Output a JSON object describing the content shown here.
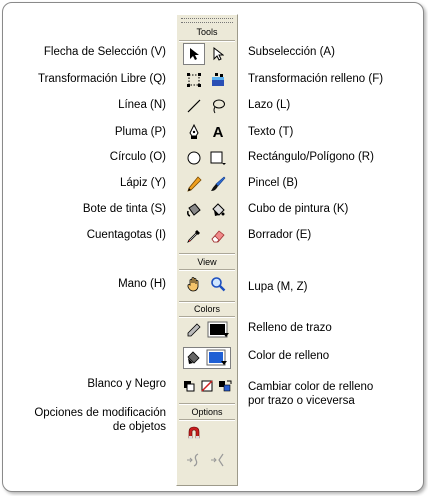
{
  "panel": {
    "tools_title": "Tools",
    "view_title": "View",
    "colors_title": "Colors",
    "options_title": "Options"
  },
  "labels_left": {
    "seleccion": "Flecha de Selección (V)",
    "transformacion_libre": "Transformación Libre (Q)",
    "linea": "Línea (N)",
    "pluma": "Pluma (P)",
    "circulo": "Círculo (O)",
    "lapiz": "Lápiz (Y)",
    "bote": "Bote de tinta (S)",
    "cuentagotas": "Cuentagotas (I)",
    "mano": "Mano (H)",
    "blanco_negro": "Blanco y Negro",
    "opciones_1": "Opciones de modificación",
    "opciones_2": "de objetos"
  },
  "labels_right": {
    "subseleccion": "Subselección (A)",
    "transformacion_relleno": "Transformación relleno (F)",
    "lazo": "Lazo (L)",
    "texto": "Texto (T)",
    "rectangulo": "Rectángulo/Polígono (R)",
    "pincel": "Pincel (B)",
    "cubo": "Cubo de pintura (K)",
    "borrador": "Borrador (E)",
    "lupa": "Lupa (M, Z)",
    "relleno_trazo": "Relleno de trazo",
    "color_relleno": "Color de relleno",
    "cambiar_1": "Cambiar color de relleno",
    "cambiar_2": "por trazo o viceversa"
  },
  "text_tool_glyph": "A",
  "colors": {
    "stroke_swatch": "#000000",
    "fill_swatch": "#1f5fd4",
    "panel_bg": "#ece9d8"
  },
  "icons": [
    "arrow-icon",
    "subselect-icon",
    "free-transform-icon",
    "fill-transform-icon",
    "line-icon",
    "lasso-icon",
    "pen-icon",
    "text-icon",
    "oval-icon",
    "rectangle-icon",
    "pencil-icon",
    "brush-icon",
    "ink-bottle-icon",
    "paint-bucket-icon",
    "eyedropper-icon",
    "eraser-icon",
    "hand-icon",
    "zoom-icon",
    "stroke-color-icon",
    "fill-color-icon",
    "black-white-icon",
    "no-color-icon",
    "swap-colors-icon",
    "magnet-icon",
    "smooth-icon",
    "straighten-icon"
  ]
}
